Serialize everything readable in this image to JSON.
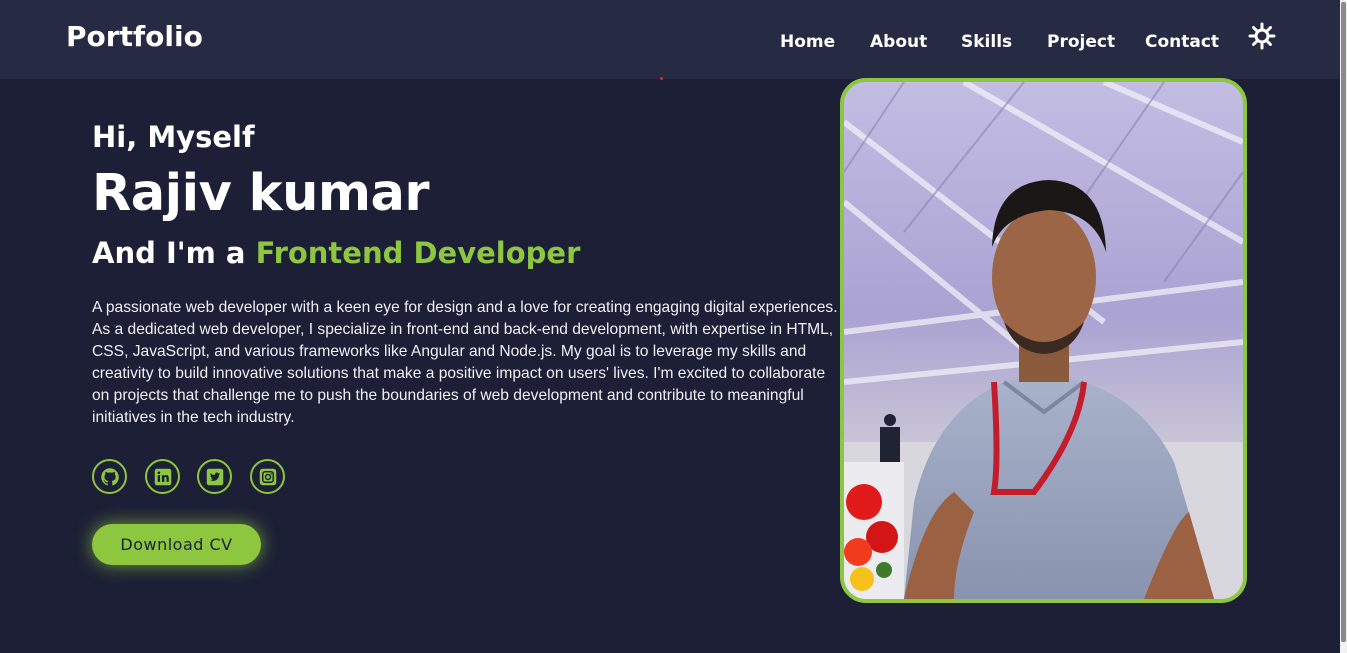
{
  "header": {
    "logo": "Portfolio",
    "nav": [
      {
        "label": "Home"
      },
      {
        "label": "About"
      },
      {
        "label": "Skills"
      },
      {
        "label": "Project"
      },
      {
        "label": "Contact"
      }
    ],
    "theme_icon": "sun-icon"
  },
  "hero": {
    "greeting": "Hi, Myself",
    "name": "Rajiv kumar",
    "role_prefix": "And I'm a",
    "role_highlight": "Frontend Developer",
    "description": "A passionate web developer with a keen eye for design and a love for creating engaging digital experiences. As a dedicated web developer, I specialize in front-end and back-end development, with expertise in HTML, CSS, JavaScript, and various frameworks like Angular and Node.js. My goal is to leverage my skills and creativity to build innovative solutions that make a positive impact on users' lives. I'm excited to collaborate on projects that challenge me to push the boundaries of web development and contribute to meaningful initiatives in the tech industry.",
    "socials": [
      {
        "icon": "github-icon"
      },
      {
        "icon": "linkedin-icon"
      },
      {
        "icon": "twitter-icon"
      },
      {
        "icon": "instagram-icon"
      }
    ],
    "cta_label": "Download CV",
    "photo_icon": "profile-photo"
  },
  "colors": {
    "background": "#1c1f36",
    "navbar": "#262a43",
    "accent": "#8dc63f",
    "text": "#ffffff"
  }
}
